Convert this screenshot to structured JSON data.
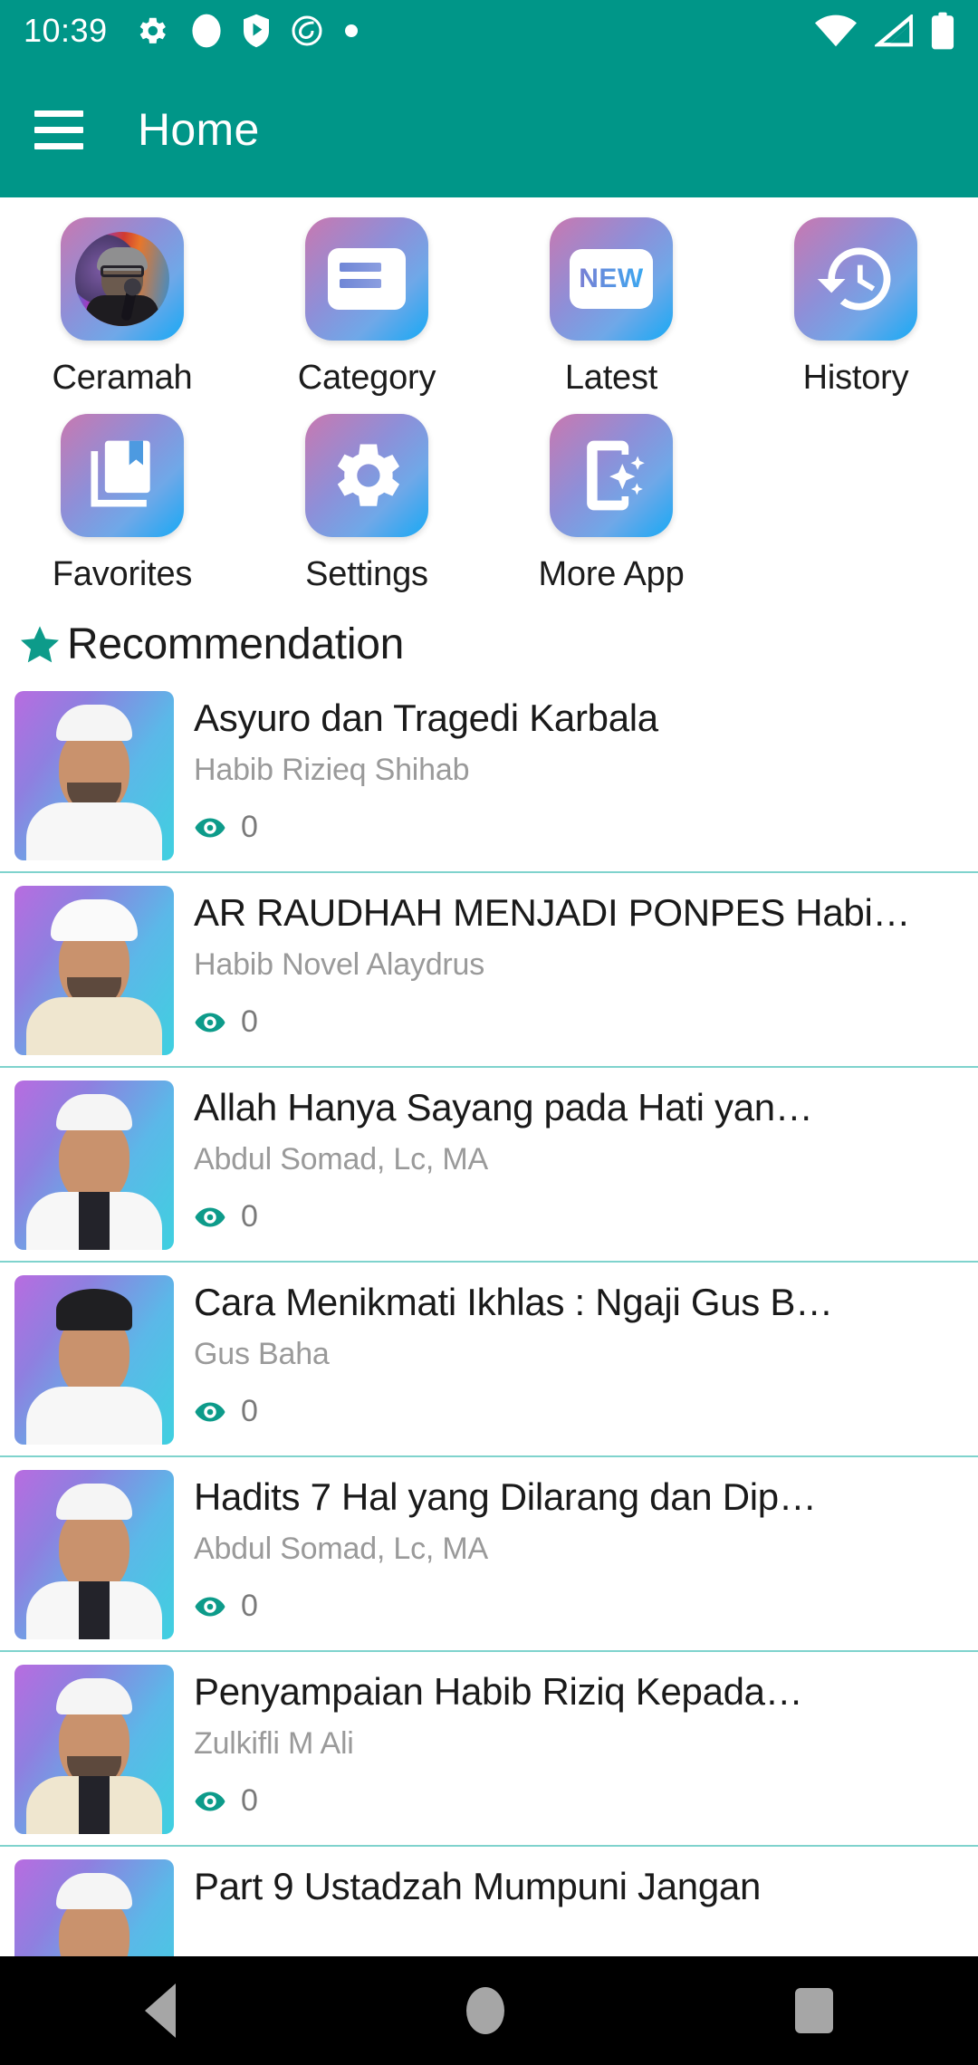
{
  "status_bar": {
    "time": "10:39",
    "left_icons": [
      "gear-icon",
      "circle-icon",
      "play-shield-icon",
      "spiral-icon",
      "dot-icon"
    ],
    "right_icons": [
      "wifi-icon",
      "cellular-signal-icon",
      "battery-icon"
    ],
    "background_color": "#009688"
  },
  "app_bar": {
    "menu_icon": "hamburger-menu-icon",
    "title": "Home",
    "background_color": "#009688",
    "text_color": "#ffffff"
  },
  "grid_menu": {
    "items": [
      {
        "label": "Ceramah",
        "icon": "speaker-photo-icon"
      },
      {
        "label": "Category",
        "icon": "card-list-icon"
      },
      {
        "label": "Latest",
        "icon": "new-badge-icon",
        "badge_text": "NEW"
      },
      {
        "label": "History",
        "icon": "history-clock-icon"
      },
      {
        "label": "Favorites",
        "icon": "bookmark-book-icon"
      },
      {
        "label": "Settings",
        "icon": "gear-icon"
      },
      {
        "label": "More App",
        "icon": "phone-sparkle-icon"
      }
    ]
  },
  "recommendation": {
    "icon": "star-icon",
    "title": "Recommendation",
    "accent_color": "#009688",
    "items": [
      {
        "title": "Asyuro dan Tragedi Karbala",
        "author": "Habib Rizieq Shihab",
        "views": "0"
      },
      {
        "title": "AR RAUDHAH MENJADI PONPES Habi…",
        "author": "Habib Novel Alaydrus",
        "views": "0"
      },
      {
        "title": "Allah Hanya Sayang pada Hati yan…",
        "author": "Abdul Somad, Lc, MA",
        "views": "0"
      },
      {
        "title": "Cara Menikmati Ikhlas : Ngaji Gus B…",
        "author": "Gus Baha",
        "views": "0"
      },
      {
        "title": "Hadits 7 Hal yang Dilarang dan Dip…",
        "author": "Abdul Somad, Lc, MA",
        "views": "0"
      },
      {
        "title": "Penyampaian Habib Riziq Kepada…",
        "author": "Zulkifli M Ali",
        "views": "0"
      },
      {
        "title": "Part 9  Ustadzah Mumpuni Jangan",
        "author": "",
        "views": ""
      }
    ]
  },
  "navigation_bar": {
    "back": "back-triangle-icon",
    "home": "home-circle-icon",
    "recents": "recents-square-icon"
  }
}
